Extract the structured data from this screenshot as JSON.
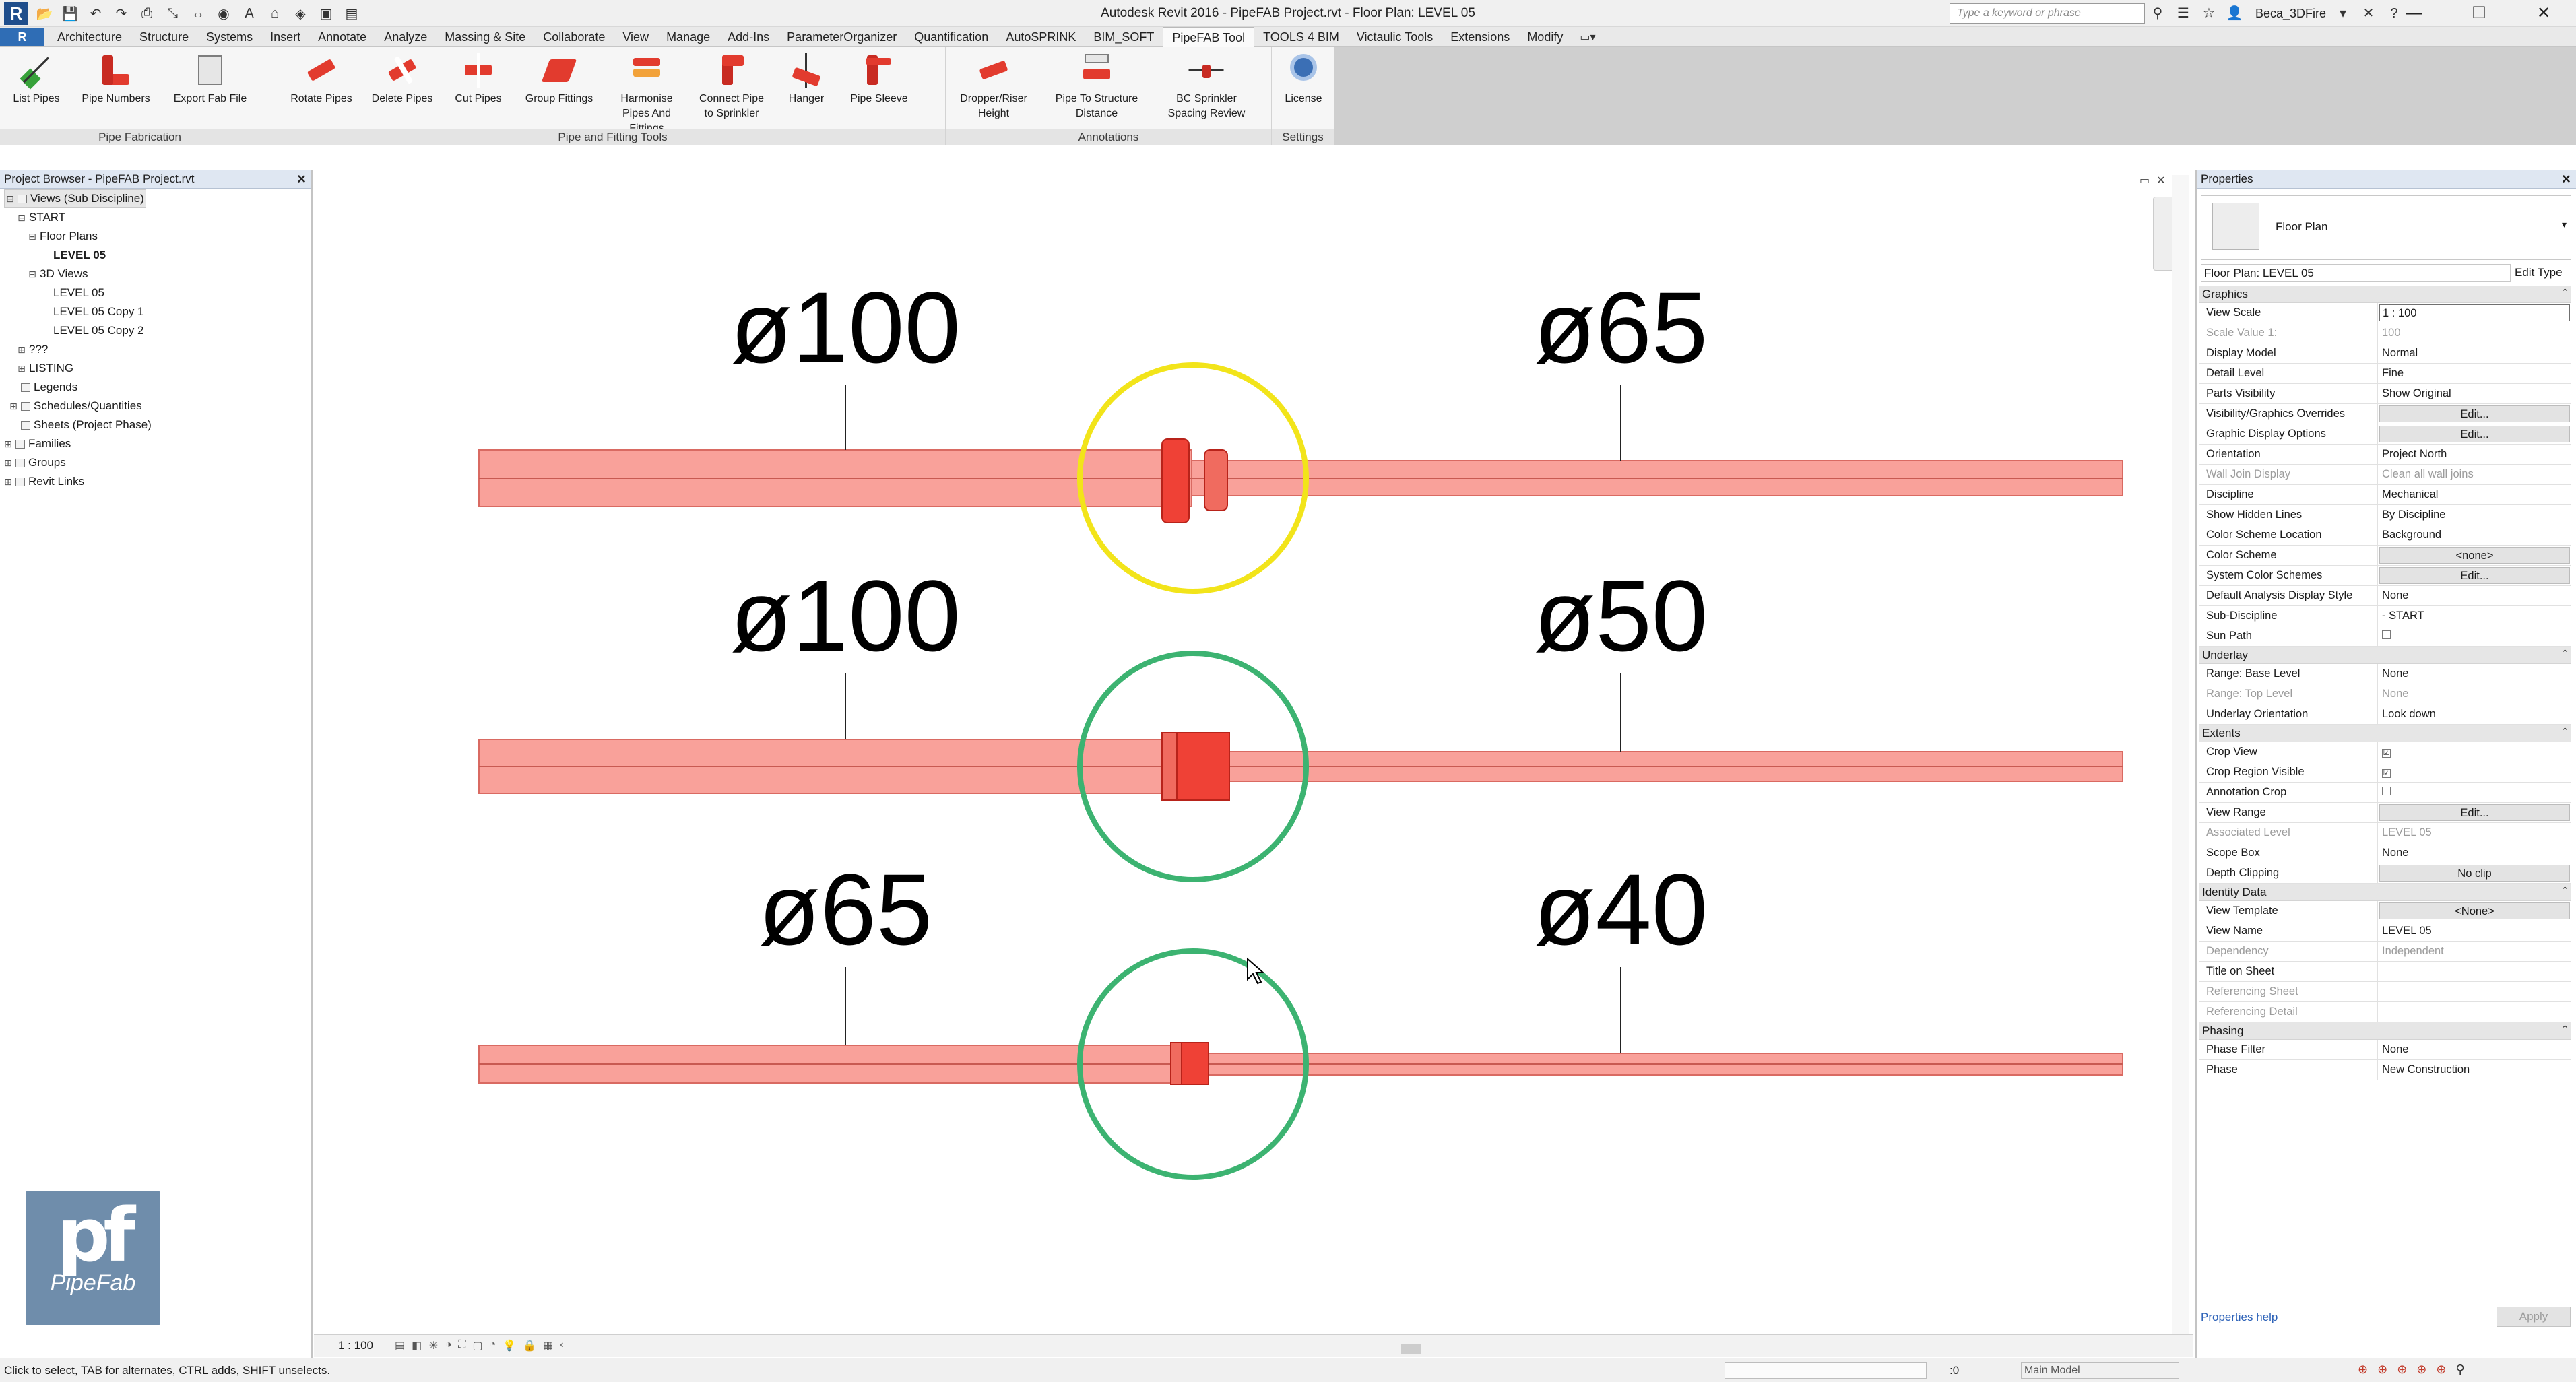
{
  "titlebar": {
    "app_logo": "R",
    "window_title": "Autodesk Revit 2016 -    PipeFAB Project.rvt - Floor Plan: LEVEL 05",
    "search_placeholder": "Type a keyword or phrase",
    "user": "Beca_3DFire",
    "qat_icons": [
      "open-icon",
      "save-icon",
      "undo-icon",
      "redo-icon",
      "print-icon",
      "measure-icon",
      "dimension-icon",
      "tag-icon",
      "text-icon",
      "3d-view-icon",
      "section-icon",
      "close-views-icon",
      "switch-windows-icon"
    ]
  },
  "ribbon": {
    "file_tab": "R",
    "tabs": [
      "Architecture",
      "Structure",
      "Systems",
      "Insert",
      "Annotate",
      "Analyze",
      "Massing & Site",
      "Collaborate",
      "View",
      "Manage",
      "Add-Ins",
      "ParameterOrganizer",
      "Quantification",
      "AutoSPRINK",
      "BIM_SOFT",
      "PipeFAB Tool",
      "TOOLS 4 BIM",
      "Victaulic Tools",
      "Extensions",
      "Modify"
    ],
    "active_tab": "PipeFAB Tool",
    "panels": {
      "fabrication": {
        "title": "Pipe Fabrication",
        "buttons": [
          "List Pipes",
          "Pipe Numbers",
          "Export Fab File"
        ]
      },
      "tools": {
        "title": "Pipe and Fitting Tools",
        "buttons": [
          "Rotate Pipes",
          "Delete Pipes",
          "Cut Pipes",
          "Group Fittings",
          "Harmonise Pipes And Fittings",
          "Connect Pipe to Sprinkler",
          "Hanger",
          "Pipe Sleeve"
        ]
      },
      "annotations": {
        "title": "Annotations",
        "buttons": [
          "Dropper/Riser Height",
          "Pipe To Structure Distance",
          "BC Sprinkler Spacing Review"
        ]
      },
      "settings": {
        "title": "Settings",
        "buttons": [
          "License"
        ]
      }
    }
  },
  "browser": {
    "title": "Project Browser - PipeFAB Project.rvt",
    "rows": [
      {
        "label": "Views (Sub Discipline)",
        "toggle": "⊟"
      },
      {
        "label": "START",
        "toggle": "⊟"
      },
      {
        "label": "Floor Plans",
        "toggle": "⊟"
      },
      {
        "label": "LEVEL 05",
        "toggle": ""
      },
      {
        "label": "3D Views",
        "toggle": "⊟"
      },
      {
        "label": "LEVEL 05",
        "toggle": ""
      },
      {
        "label": "LEVEL 05 Copy 1",
        "toggle": ""
      },
      {
        "label": "LEVEL 05 Copy 2",
        "toggle": ""
      },
      {
        "label": "???",
        "toggle": "⊞"
      },
      {
        "label": "LISTING",
        "toggle": "⊞"
      },
      {
        "label": "Legends",
        "toggle": ""
      },
      {
        "label": "Schedules/Quantities",
        "toggle": "⊞"
      },
      {
        "label": "Sheets (Project Phase)",
        "toggle": ""
      },
      {
        "label": "Families",
        "toggle": "⊞"
      },
      {
        "label": "Groups",
        "toggle": "⊞"
      },
      {
        "label": "Revit Links",
        "toggle": "⊞"
      }
    ],
    "logo_text": "PipeFab"
  },
  "drawing": {
    "scale": "1 : 100",
    "pipes": [
      {
        "left_label": "ø100",
        "right_label": "ø65",
        "circle_color": "#f2e41a"
      },
      {
        "left_label": "ø100",
        "right_label": "ø50",
        "circle_color": "#3cb371"
      },
      {
        "left_label": "ø65",
        "right_label": "ø40",
        "circle_color": "#3cb371"
      }
    ],
    "pipe_color": "#f9a19a",
    "fitting_color": "#ef4136"
  },
  "properties": {
    "title": "Properties",
    "type_name": "Floor Plan",
    "instance": "Floor Plan: LEVEL 05",
    "edit_type": "Edit Type",
    "groups": [
      {
        "name": "Graphics",
        "rows": [
          {
            "name": "View Scale",
            "value": "1 : 100",
            "style": "box"
          },
          {
            "name": "Scale Value    1:",
            "value": "100",
            "style": "dim"
          },
          {
            "name": "Display Model",
            "value": "Normal"
          },
          {
            "name": "Detail Level",
            "value": "Fine"
          },
          {
            "name": "Parts Visibility",
            "value": "Show Original"
          },
          {
            "name": "Visibility/Graphics Overrides",
            "value": "Edit...",
            "style": "btn"
          },
          {
            "name": "Graphic Display Options",
            "value": "Edit...",
            "style": "btn"
          },
          {
            "name": "Orientation",
            "value": "Project North"
          },
          {
            "name": "Wall Join Display",
            "value": "Clean all wall joins",
            "style": "dim"
          },
          {
            "name": "Discipline",
            "value": "Mechanical"
          },
          {
            "name": "Show Hidden Lines",
            "value": "By Discipline"
          },
          {
            "name": "Color Scheme Location",
            "value": "Background"
          },
          {
            "name": "Color Scheme",
            "value": "<none>",
            "style": "btn"
          },
          {
            "name": "System Color Schemes",
            "value": "Edit...",
            "style": "btn"
          },
          {
            "name": "Default Analysis Display Style",
            "value": "None"
          },
          {
            "name": "Sub-Discipline",
            "value": "- START"
          },
          {
            "name": "Sun Path",
            "value": "",
            "style": "chk"
          }
        ]
      },
      {
        "name": "Underlay",
        "rows": [
          {
            "name": "Range: Base Level",
            "value": "None"
          },
          {
            "name": "Range: Top Level",
            "value": "None",
            "style": "dim"
          },
          {
            "name": "Underlay Orientation",
            "value": "Look down"
          }
        ]
      },
      {
        "name": "Extents",
        "rows": [
          {
            "name": "Crop View",
            "value": "☑",
            "style": "chk"
          },
          {
            "name": "Crop Region Visible",
            "value": "☑",
            "style": "chk"
          },
          {
            "name": "Annotation Crop",
            "value": "",
            "style": "chk"
          },
          {
            "name": "View Range",
            "value": "Edit...",
            "style": "btn"
          },
          {
            "name": "Associated Level",
            "value": "LEVEL 05",
            "style": "dim"
          },
          {
            "name": "Scope Box",
            "value": "None"
          },
          {
            "name": "Depth Clipping",
            "value": "No clip",
            "style": "btn"
          }
        ]
      },
      {
        "name": "Identity Data",
        "rows": [
          {
            "name": "View Template",
            "value": "<None>",
            "style": "btn"
          },
          {
            "name": "View Name",
            "value": "LEVEL 05"
          },
          {
            "name": "Dependency",
            "value": "Independent",
            "style": "dim"
          },
          {
            "name": "Title on Sheet",
            "value": ""
          },
          {
            "name": "Referencing Sheet",
            "value": "",
            "style": "dim"
          },
          {
            "name": "Referencing Detail",
            "value": "",
            "style": "dim"
          }
        ]
      },
      {
        "name": "Phasing",
        "rows": [
          {
            "name": "Phase Filter",
            "value": "None"
          },
          {
            "name": "Phase",
            "value": "New Construction"
          }
        ]
      }
    ],
    "help_link": "Properties help",
    "apply": "Apply"
  },
  "status": {
    "text": "Click to select, TAB for alternates, CTRL adds, SHIFT unselects.",
    "zero": ":0",
    "model": "Main Model"
  }
}
